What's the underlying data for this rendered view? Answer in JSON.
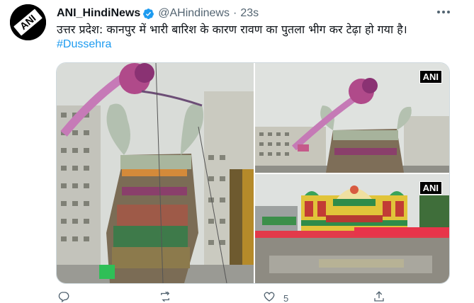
{
  "tweet": {
    "display_name": "ANI_HindiNews",
    "handle": "@AHindinews",
    "separator": "·",
    "time": "23s",
    "text": "उत्तर प्रदेश: कानपुर में भारी बारिश के कारण रावण का पुतला भीग कर टेढ़ा हो गया है।",
    "hashtag": "#Dussehra",
    "avatar_text": "ANI"
  },
  "media": {
    "watermark": "ANI"
  },
  "actions": {
    "reply_count": "",
    "retweet_count": "",
    "like_count": "5",
    "share_count": ""
  },
  "icons": {
    "verified": "verified-badge-icon",
    "more": "more-options-icon",
    "reply": "reply-icon",
    "retweet": "retweet-icon",
    "like": "heart-icon",
    "share": "share-icon"
  },
  "colors": {
    "accent": "#1d9bf0",
    "secondary_text": "#536471",
    "primary_text": "#0f1419"
  }
}
